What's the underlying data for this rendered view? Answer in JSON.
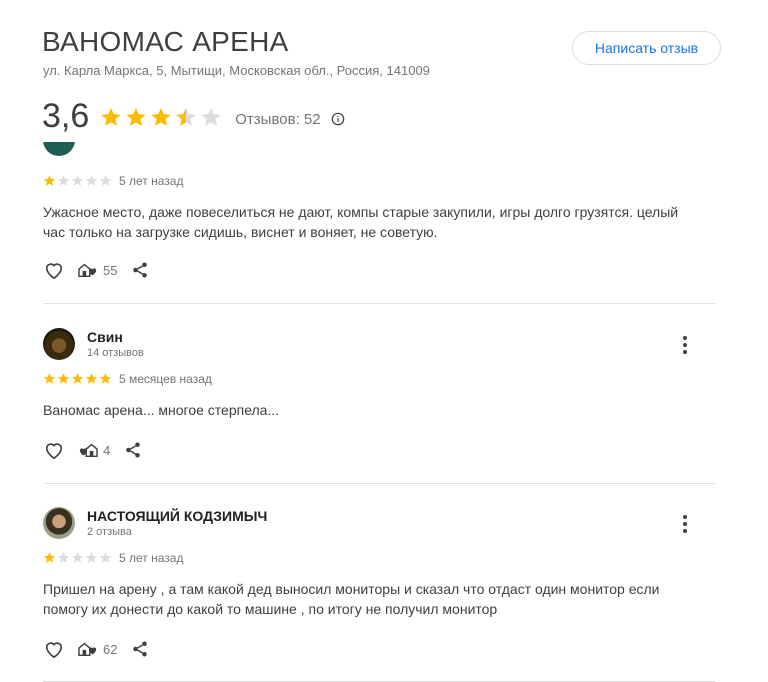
{
  "place": {
    "title": "ВАНОМАС АРЕНА",
    "address": "ул. Карла Маркса, 5, Мытищи, Московская обл., Россия, 141009"
  },
  "write_review_label": "Написать отзыв",
  "rating": {
    "value": "3,6",
    "stars": 3.5,
    "reviews_label": "Отзывов: 52"
  },
  "colors": {
    "star": "#fbbc04",
    "star_empty": "#dadce0",
    "accent": "#1a73e8"
  },
  "reviews": [
    {
      "stars": 1,
      "time": "5 лет назад",
      "text": "Ужасное место, даже повеселиться не дают, компы старые закупили, игры долго грузятся. целый час только на загрузке сидишь, виснет и воняет, не советую.",
      "useful_count": "55"
    },
    {
      "author": "Свин",
      "author_meta": "14 отзывов",
      "stars": 5,
      "time": "5 месяцев назад",
      "text": "Ваномас арена... многое стерпела...",
      "useful_count": "4"
    },
    {
      "author": "НАСТОЯЩИЙ КОДЗИМЫЧ",
      "author_meta": "2 отзыва",
      "stars": 1,
      "time": "5 лет назад",
      "text": "Пришел на арену , а там какой дед выносил мониторы и сказал что отдаст один монитор если помогу их донести до какой то машине , по итогу не получил монитор",
      "useful_count": "62"
    }
  ]
}
